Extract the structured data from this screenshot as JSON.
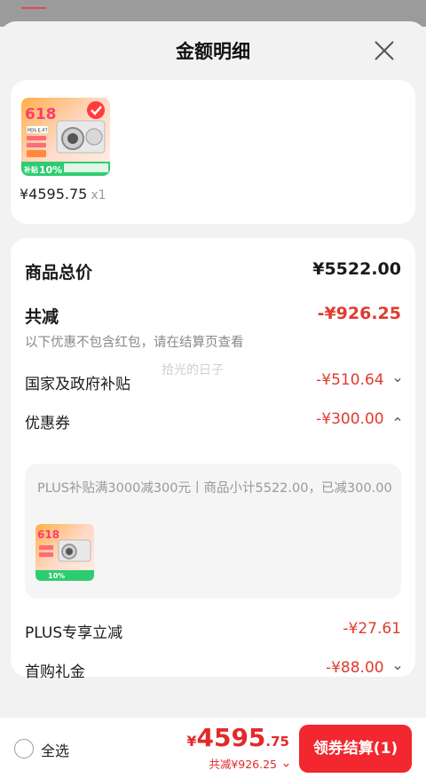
{
  "sheet": {
    "title": "金额明细"
  },
  "product": {
    "price": "¥4595.75",
    "qty": "x1"
  },
  "details": {
    "total_label": "商品总价",
    "total_value": "¥5522.00",
    "discount_label": "共减",
    "discount_value": "-¥926.25",
    "note": "以下优惠不包含红包，请在结算页查看",
    "watermark": "拾光的日子",
    "gov_subsidy": {
      "label": "国家及政府补贴",
      "value": "-¥510.64"
    },
    "coupon": {
      "label": "优惠券",
      "value": "-¥300.00",
      "detail": "PLUS补贴满3000减300元丨商品小计5522.00，已减300.00"
    },
    "plus": {
      "label": "PLUS专享立减",
      "value": "-¥27.61"
    },
    "first_buy": {
      "label": "首购礼金",
      "value": "-¥88.00"
    }
  },
  "thumb_text": {
    "badge": "618",
    "model": "PEN E-P7",
    "subsidy": "补贴",
    "percent": "10%"
  },
  "bottom": {
    "select_all": "全选",
    "currency": "¥",
    "total_int": "4595",
    "total_dec": ".75",
    "total_discount": "共减¥926.25",
    "checkout": "领券结算(1)"
  },
  "colors": {
    "accent": "#e23a2e",
    "button": "#f2272f"
  }
}
